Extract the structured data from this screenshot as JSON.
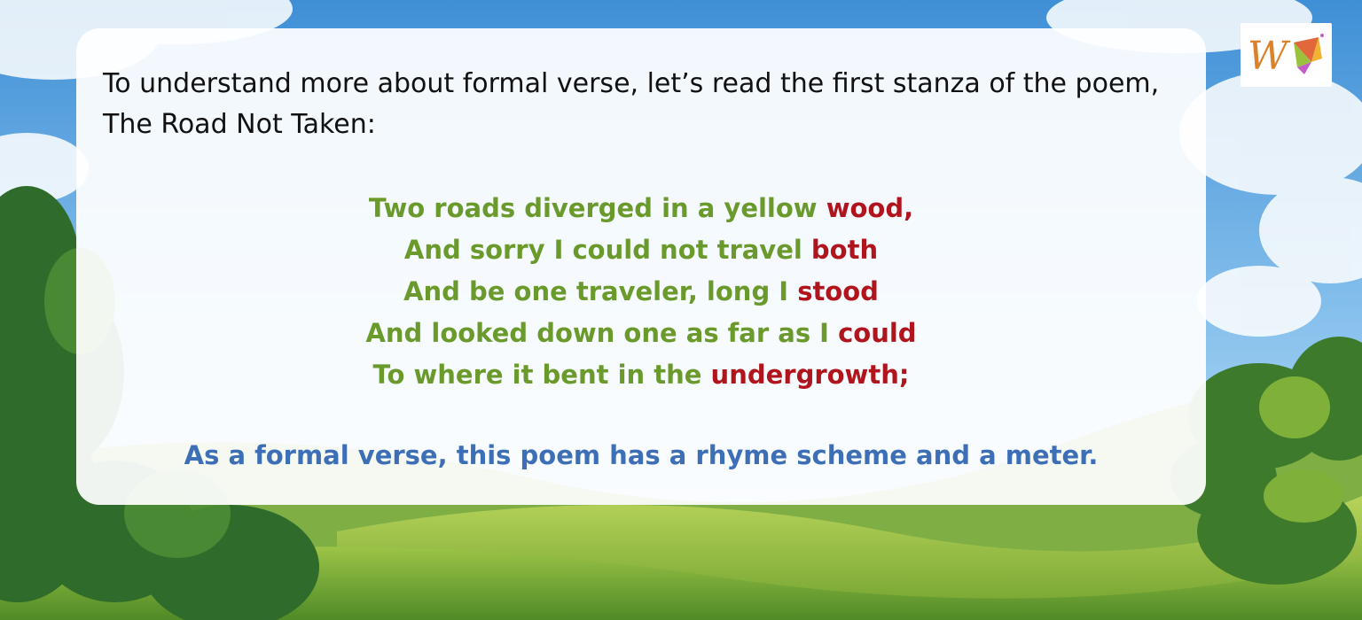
{
  "colors": {
    "verse_green": "#6a9a2c",
    "rhyme_red": "#b0141c",
    "conclusion_blue": "#3d6fb6",
    "intro_text": "#111111"
  },
  "intro": "To understand more about formal verse,  let’s read the first stanza of the poem, The Road Not Taken:",
  "stanza": [
    {
      "text": "Two roads diverged in a yellow ",
      "rhyme": "wood,"
    },
    {
      "text": "And sorry I could not travel ",
      "rhyme": "both"
    },
    {
      "text": "And be one traveler, long I ",
      "rhyme": "stood"
    },
    {
      "text": "And looked down one as far as I ",
      "rhyme": "could"
    },
    {
      "text": "To where it bent in the ",
      "rhyme": "undergrowth;"
    }
  ],
  "conclusion": "As a formal verse, this poem has a rhyme scheme and a meter.",
  "logo": {
    "icon": "w-kite-logo",
    "letter": "W"
  }
}
